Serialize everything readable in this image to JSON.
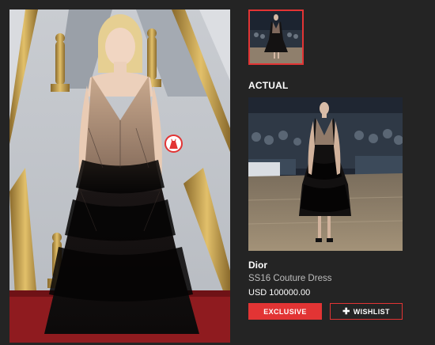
{
  "colors": {
    "background": "#242424",
    "accent": "#e23434",
    "text_primary": "#ffffff",
    "text_secondary": "#bdbdbd"
  },
  "main_photo": {
    "tag_marker_icon": "dress-icon"
  },
  "actual_section": {
    "heading": "ACTUAL",
    "brand": "Dior",
    "product_name": "SS16 Couture Dress",
    "price": "USD 100000.00",
    "exclusive_label": "EXCLUSIVE",
    "wishlist_label": "WISHLIST",
    "wishlist_icon": "plus-icon"
  }
}
